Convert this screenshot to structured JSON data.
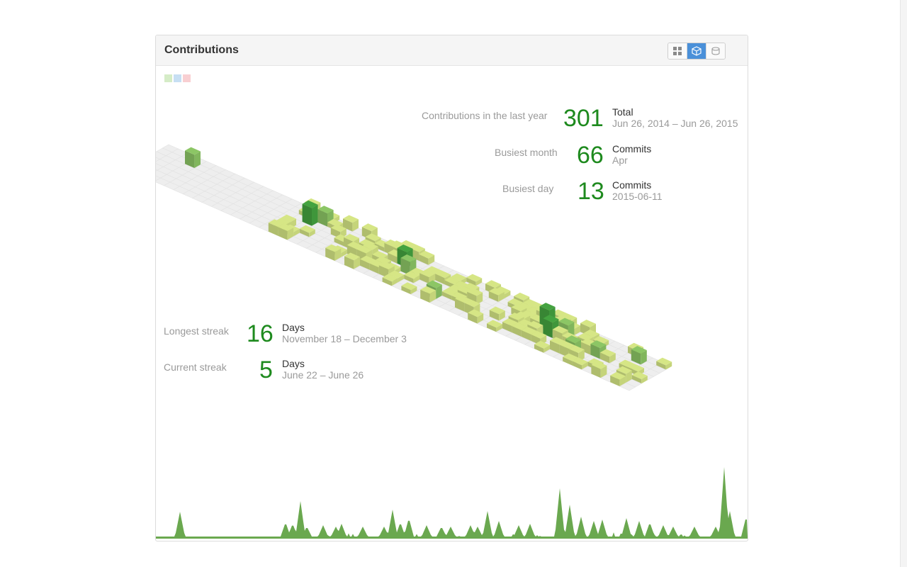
{
  "panel": {
    "title": "Contributions",
    "view_buttons": [
      {
        "icon": "grid-icon",
        "active": false
      },
      {
        "icon": "cube-icon",
        "active": true
      },
      {
        "icon": "database-icon",
        "active": false
      }
    ]
  },
  "legend": {
    "swatches": [
      "#d5ecc7",
      "#c7dff3",
      "#f8cfd2"
    ]
  },
  "stats": {
    "year": {
      "label": "Contributions in the last year",
      "value": "301",
      "unit": "Total",
      "sub": "Jun 26, 2014 – Jun 26, 2015"
    },
    "busiest_month": {
      "label": "Busiest month",
      "value": "66",
      "unit": "Commits",
      "sub": "Apr"
    },
    "busiest_day": {
      "label": "Busiest day",
      "value": "13",
      "unit": "Commits",
      "sub": "2015-06-11"
    },
    "longest_streak": {
      "label": "Longest streak",
      "value": "16",
      "unit": "Days",
      "sub": "November 18 – December 3"
    },
    "current_streak": {
      "label": "Current streak",
      "value": "5",
      "unit": "Days",
      "sub": "June 22 – June 26"
    }
  },
  "colors": {
    "accent_number": "#1e8a1e",
    "level_1": "#d6e685",
    "level_2": "#8cc665",
    "level_3": "#44a340",
    "level_4": "#1e6823",
    "empty_cell": "#eeeeee",
    "timeline": "#6aa84f"
  }
}
